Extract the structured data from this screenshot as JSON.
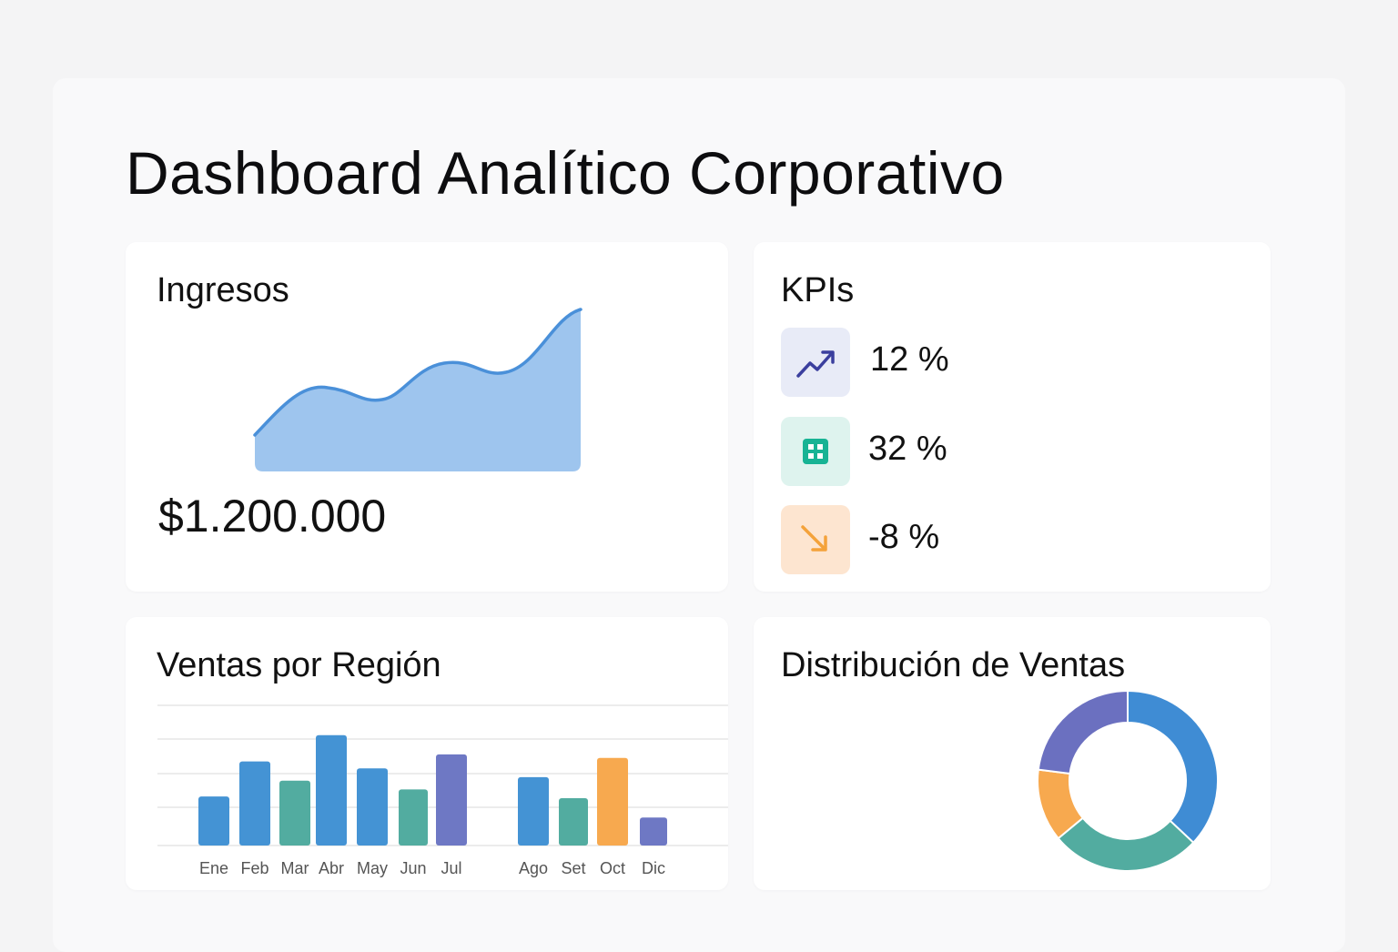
{
  "page": {
    "title": "Dashboard Analítico Corporativo"
  },
  "revenue": {
    "title": "Ingresos",
    "value": "$1.200.000",
    "trend_color": "#4a90d9",
    "fill_color": "#9ec5ee"
  },
  "kpis": {
    "title": "KPIs",
    "items": [
      {
        "value": "12 %",
        "icon": "trending-up-icon",
        "bg": "#e8ebf7",
        "fg": "#3b3f9e"
      },
      {
        "value": "32 %",
        "icon": "grid-icon",
        "bg": "#def3ee",
        "fg": "#17b394"
      },
      {
        "value": "-8 %",
        "icon": "arrow-down-right-icon",
        "bg": "#fde5d0",
        "fg": "#f4a23a"
      }
    ]
  },
  "chart_data": [
    {
      "type": "bar",
      "title": "Ventas por Región",
      "categories": [
        "Ene",
        "Feb",
        "Mar",
        "Abr",
        "May",
        "Jun",
        "Jul",
        "Ago",
        "Set",
        "Oct",
        "Dic"
      ],
      "values": [
        28,
        48,
        37,
        63,
        44,
        32,
        52,
        39,
        27,
        50,
        16
      ],
      "colors": [
        "#4493d4",
        "#4493d4",
        "#52aca0",
        "#4493d4",
        "#4493d4",
        "#52aca0",
        "#6e78c4",
        "#4493d4",
        "#52aca0",
        "#f7a94f",
        "#6e78c4"
      ],
      "grid": true
    },
    {
      "type": "pie",
      "title": "Distribución de Ventas",
      "values": [
        37,
        27,
        13,
        23
      ],
      "colors": [
        "#3f8cd4",
        "#52aca0",
        "#f7a94f",
        "#6b70c0"
      ]
    }
  ]
}
